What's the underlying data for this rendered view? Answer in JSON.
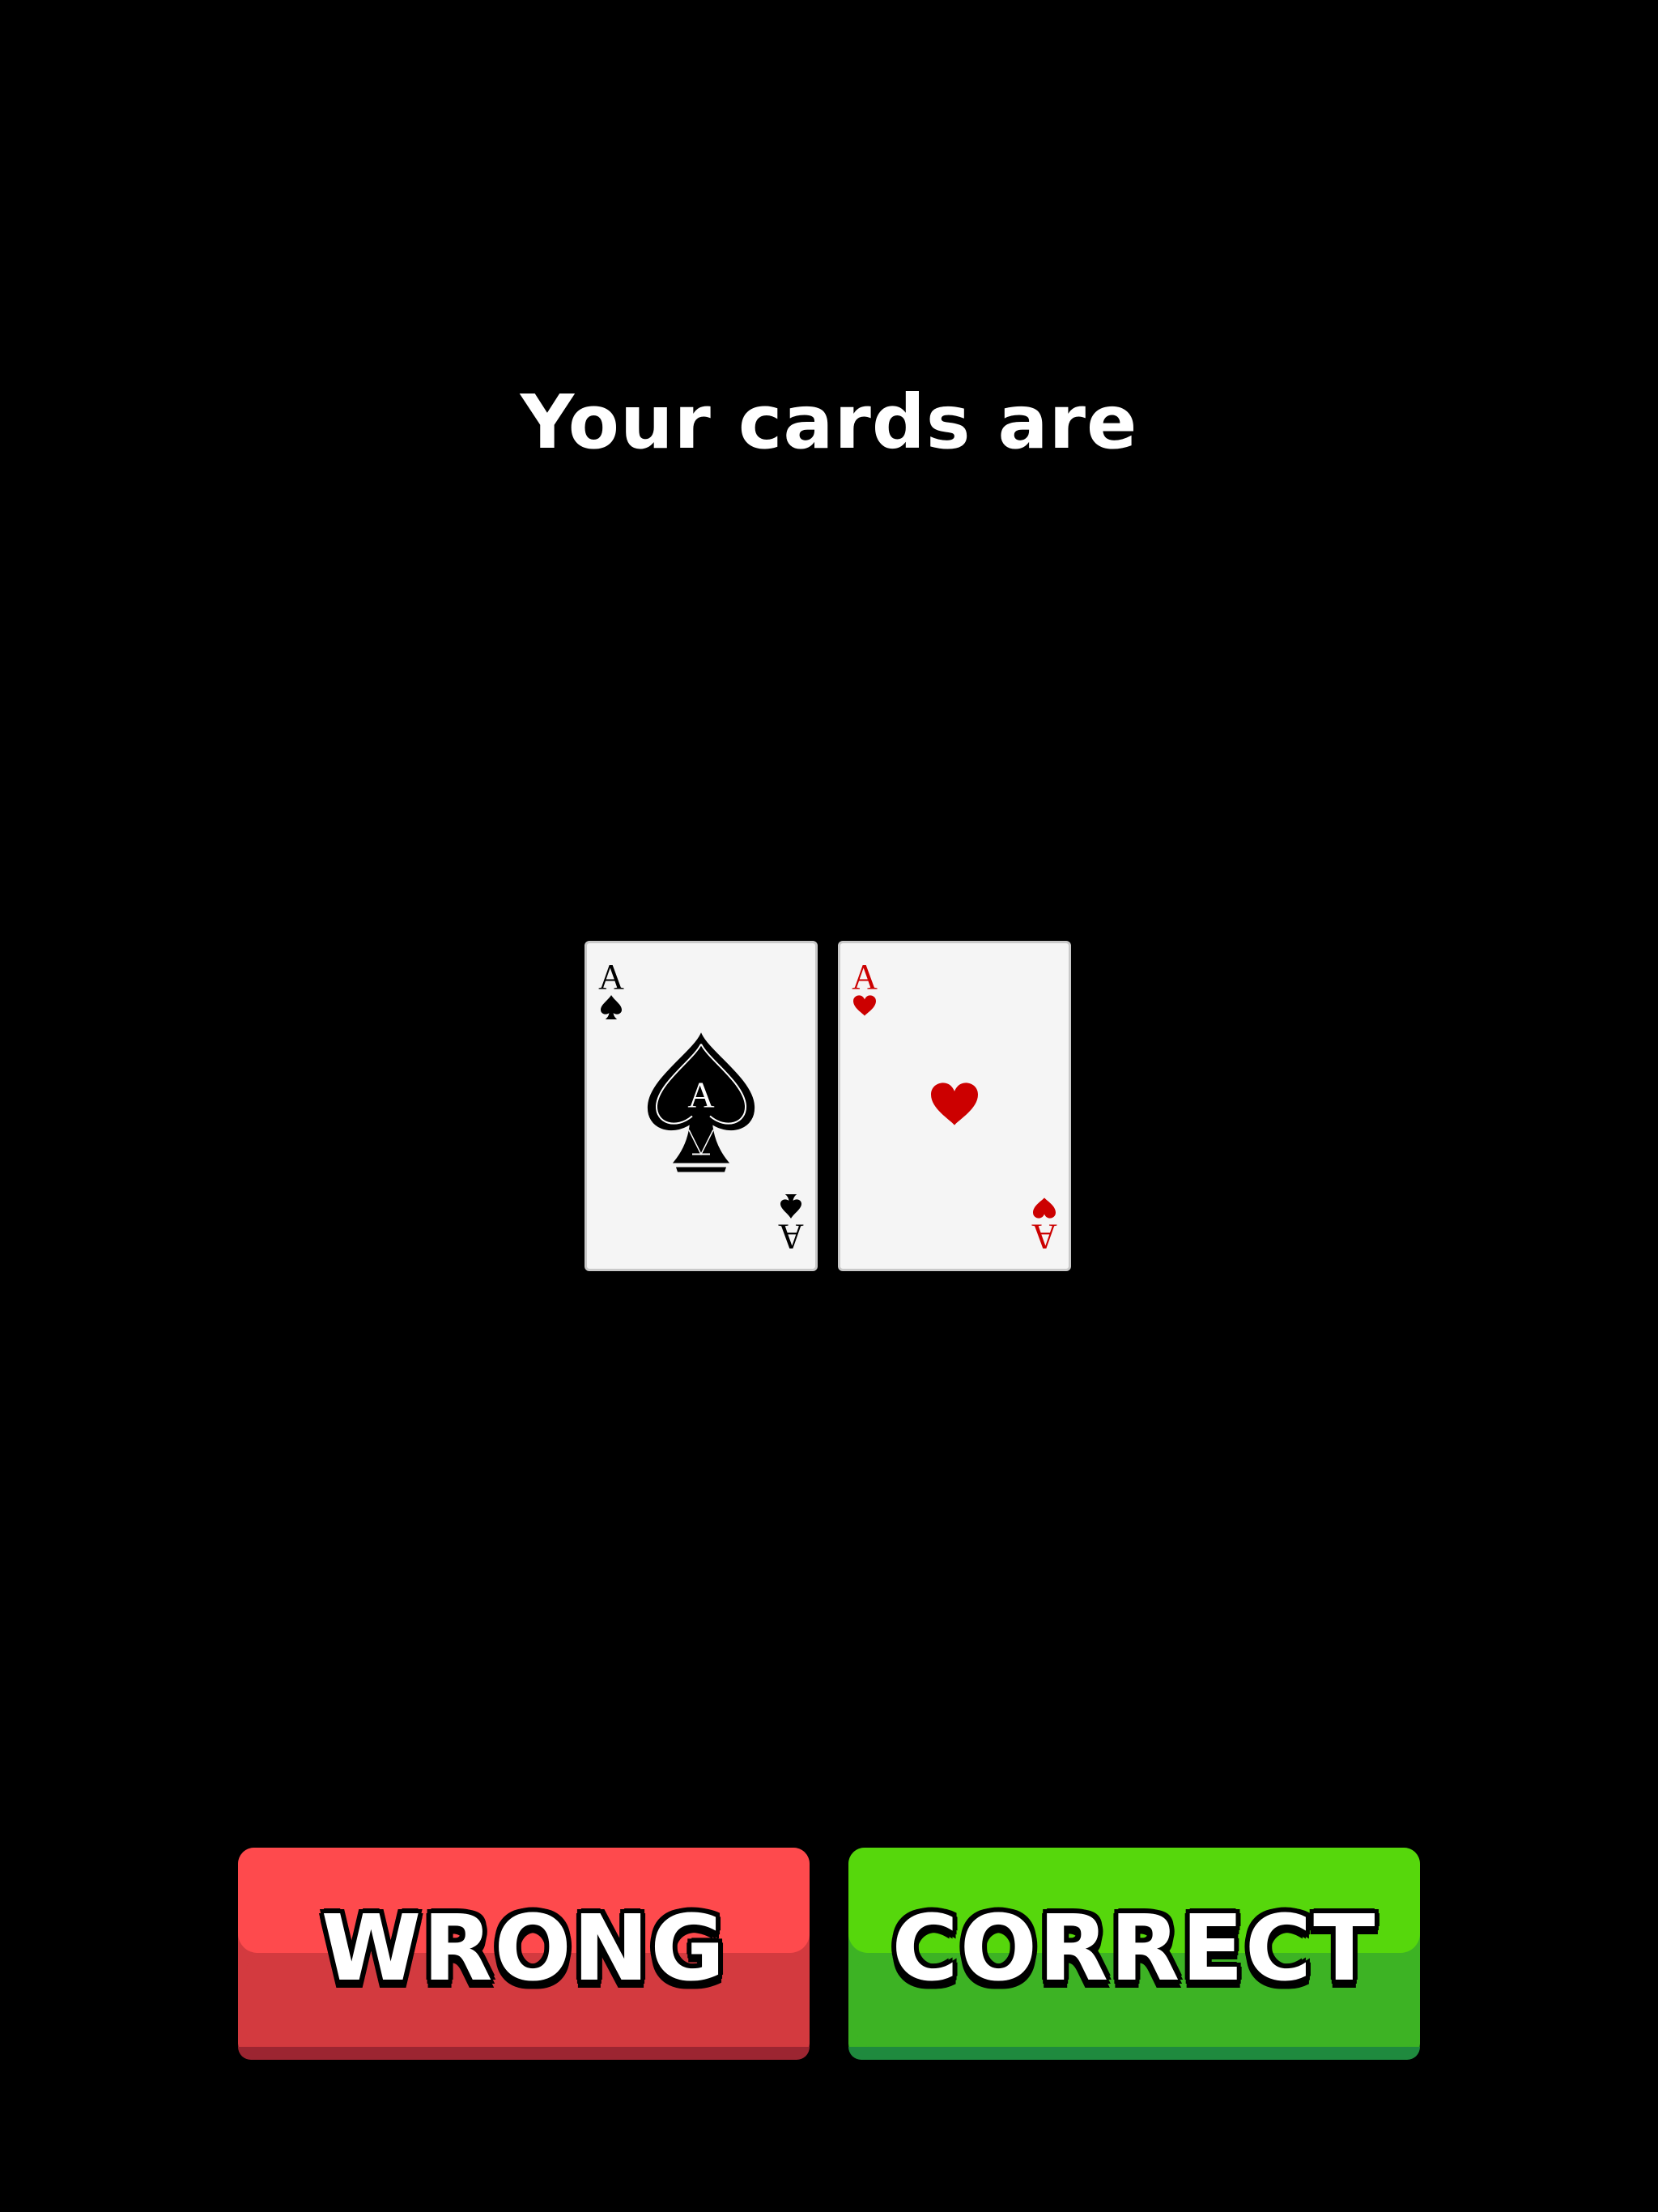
{
  "screen": {
    "title": "Your cards are"
  },
  "cards": [
    {
      "rank": "A",
      "suit": "spades",
      "suit_icon": "spade-icon",
      "color": "#000000",
      "center_label": "A"
    },
    {
      "rank": "A",
      "suit": "hearts",
      "suit_icon": "heart-icon",
      "color": "#cc0000"
    }
  ],
  "buttons": {
    "wrong_label": "WRONG",
    "correct_label": "CORRECT"
  },
  "colors": {
    "background": "#000000",
    "wrong_button": "#fe4a4d",
    "correct_button": "#56d70c",
    "red_suit": "#cc0000"
  }
}
